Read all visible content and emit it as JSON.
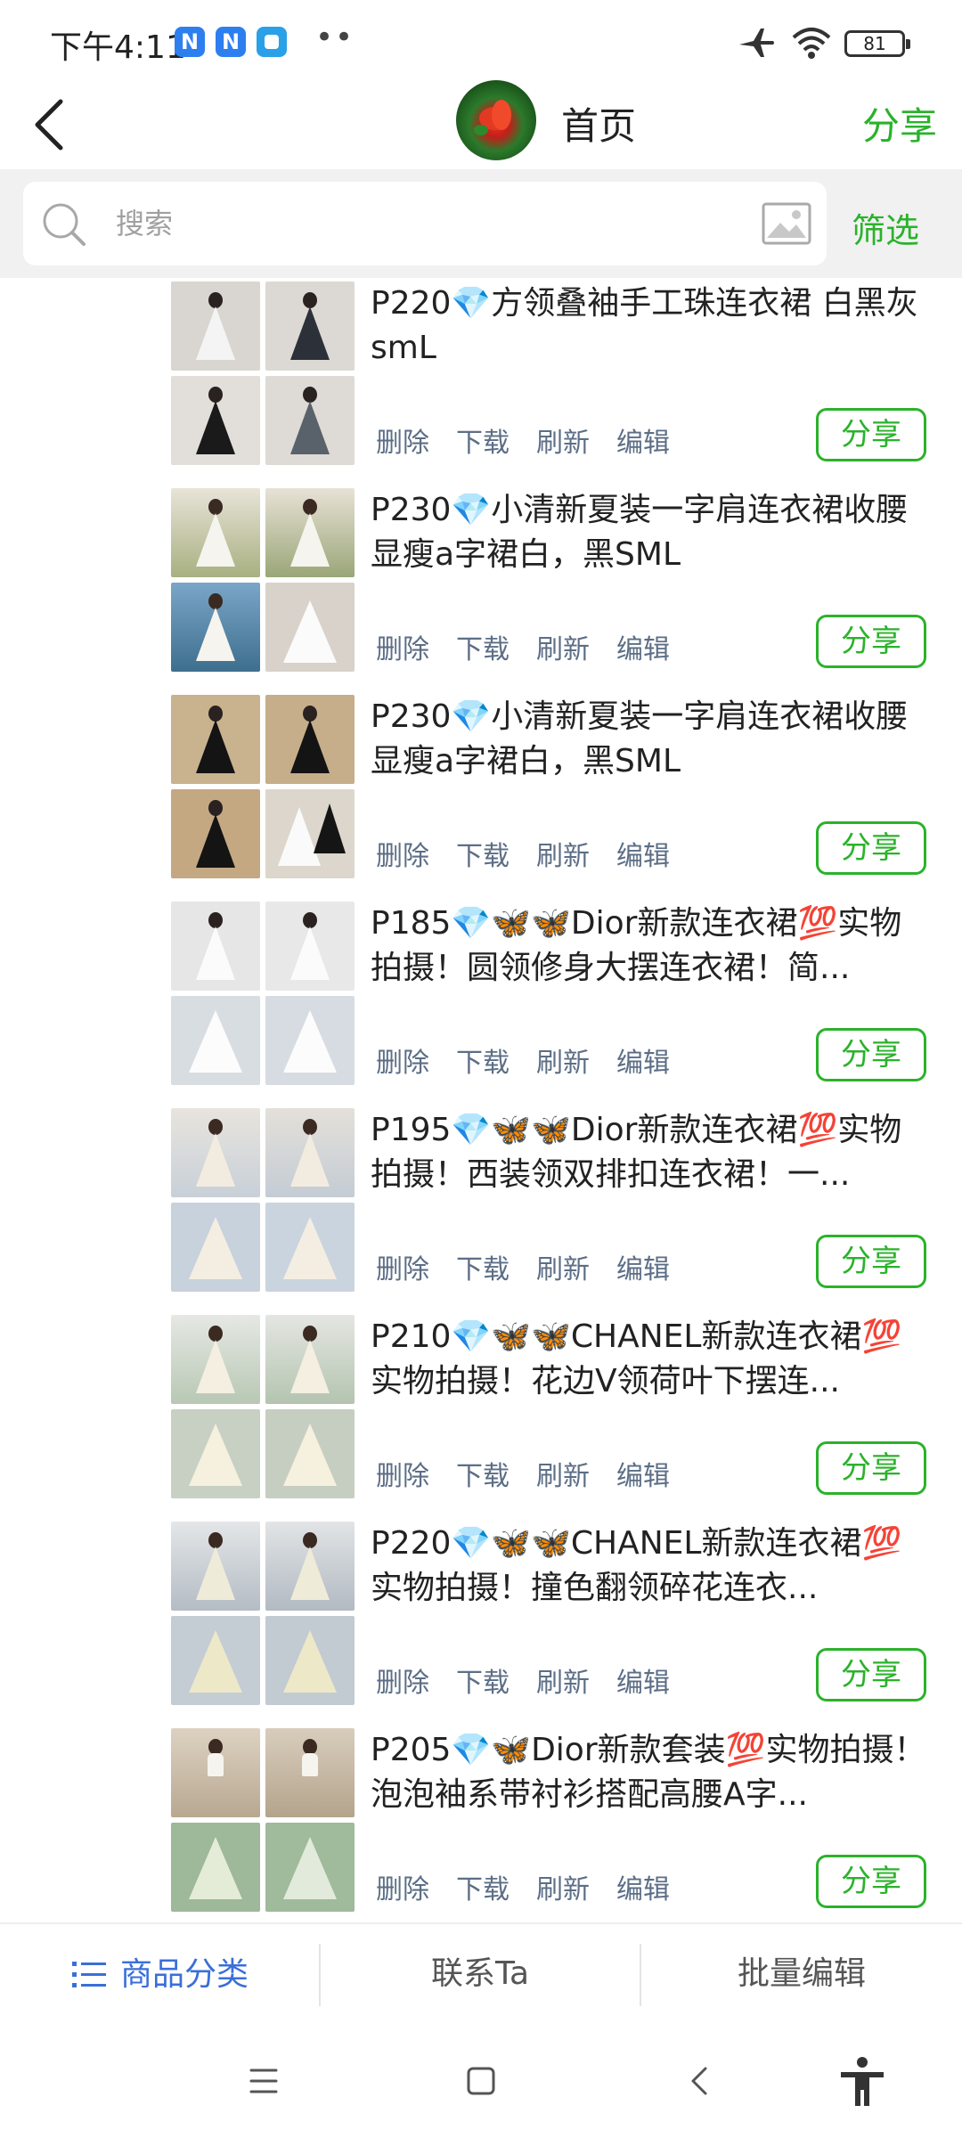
{
  "status_bar": {
    "time": "下午4:11",
    "badges": [
      "N",
      "N",
      ""
    ],
    "dots": "••",
    "battery": "81"
  },
  "header": {
    "title": "首页",
    "share_label": "分享"
  },
  "search": {
    "placeholder": "搜索",
    "filter_label": "筛选"
  },
  "products": [
    {
      "title": "P220💎方领叠袖手工珠连衣裙 白黑灰smL",
      "actions": [
        "删除",
        "下载",
        "刷新",
        "编辑"
      ],
      "share": "分享"
    },
    {
      "title": "P230💎小清新夏装一字肩连衣裙收腰显瘦a字裙白，黑SML",
      "actions": [
        "删除",
        "下载",
        "刷新",
        "编辑"
      ],
      "share": "分享"
    },
    {
      "title": "P230💎小清新夏装一字肩连衣裙收腰显瘦a字裙白，黑SML",
      "actions": [
        "删除",
        "下载",
        "刷新",
        "编辑"
      ],
      "share": "分享"
    },
    {
      "title": "P185💎🦋🦋Dior新款连衣裙💯实物拍摄！圆领修身大摆连衣裙！简...",
      "actions": [
        "删除",
        "下载",
        "刷新",
        "编辑"
      ],
      "share": "分享"
    },
    {
      "title": "P195💎🦋🦋Dior新款连衣裙💯实物拍摄！西装领双排扣连衣裙！一...",
      "actions": [
        "删除",
        "下载",
        "刷新",
        "编辑"
      ],
      "share": "分享"
    },
    {
      "title": "P210💎🦋🦋CHANEL新款连衣裙💯实物拍摄！花边V领荷叶下摆连...",
      "actions": [
        "删除",
        "下载",
        "刷新",
        "编辑"
      ],
      "share": "分享"
    },
    {
      "title": "P220💎🦋🦋CHANEL新款连衣裙💯实物拍摄！撞色翻领碎花连衣...",
      "actions": [
        "删除",
        "下载",
        "刷新",
        "编辑"
      ],
      "share": "分享"
    },
    {
      "title": "P205💎🦋Dior新款套装💯实物拍摄！泡泡袖系带衬衫搭配高腰A字...",
      "actions": [
        "删除",
        "下载",
        "刷新",
        "编辑"
      ],
      "share": "分享"
    }
  ],
  "bottom_nav": {
    "category": "商品分类",
    "contact": "联系Ta",
    "batch_edit": "批量编辑"
  },
  "theme": {
    "accent": "#2bb22b",
    "action_text": "#5c6e86",
    "nav_icon": "#3a6fd8"
  }
}
